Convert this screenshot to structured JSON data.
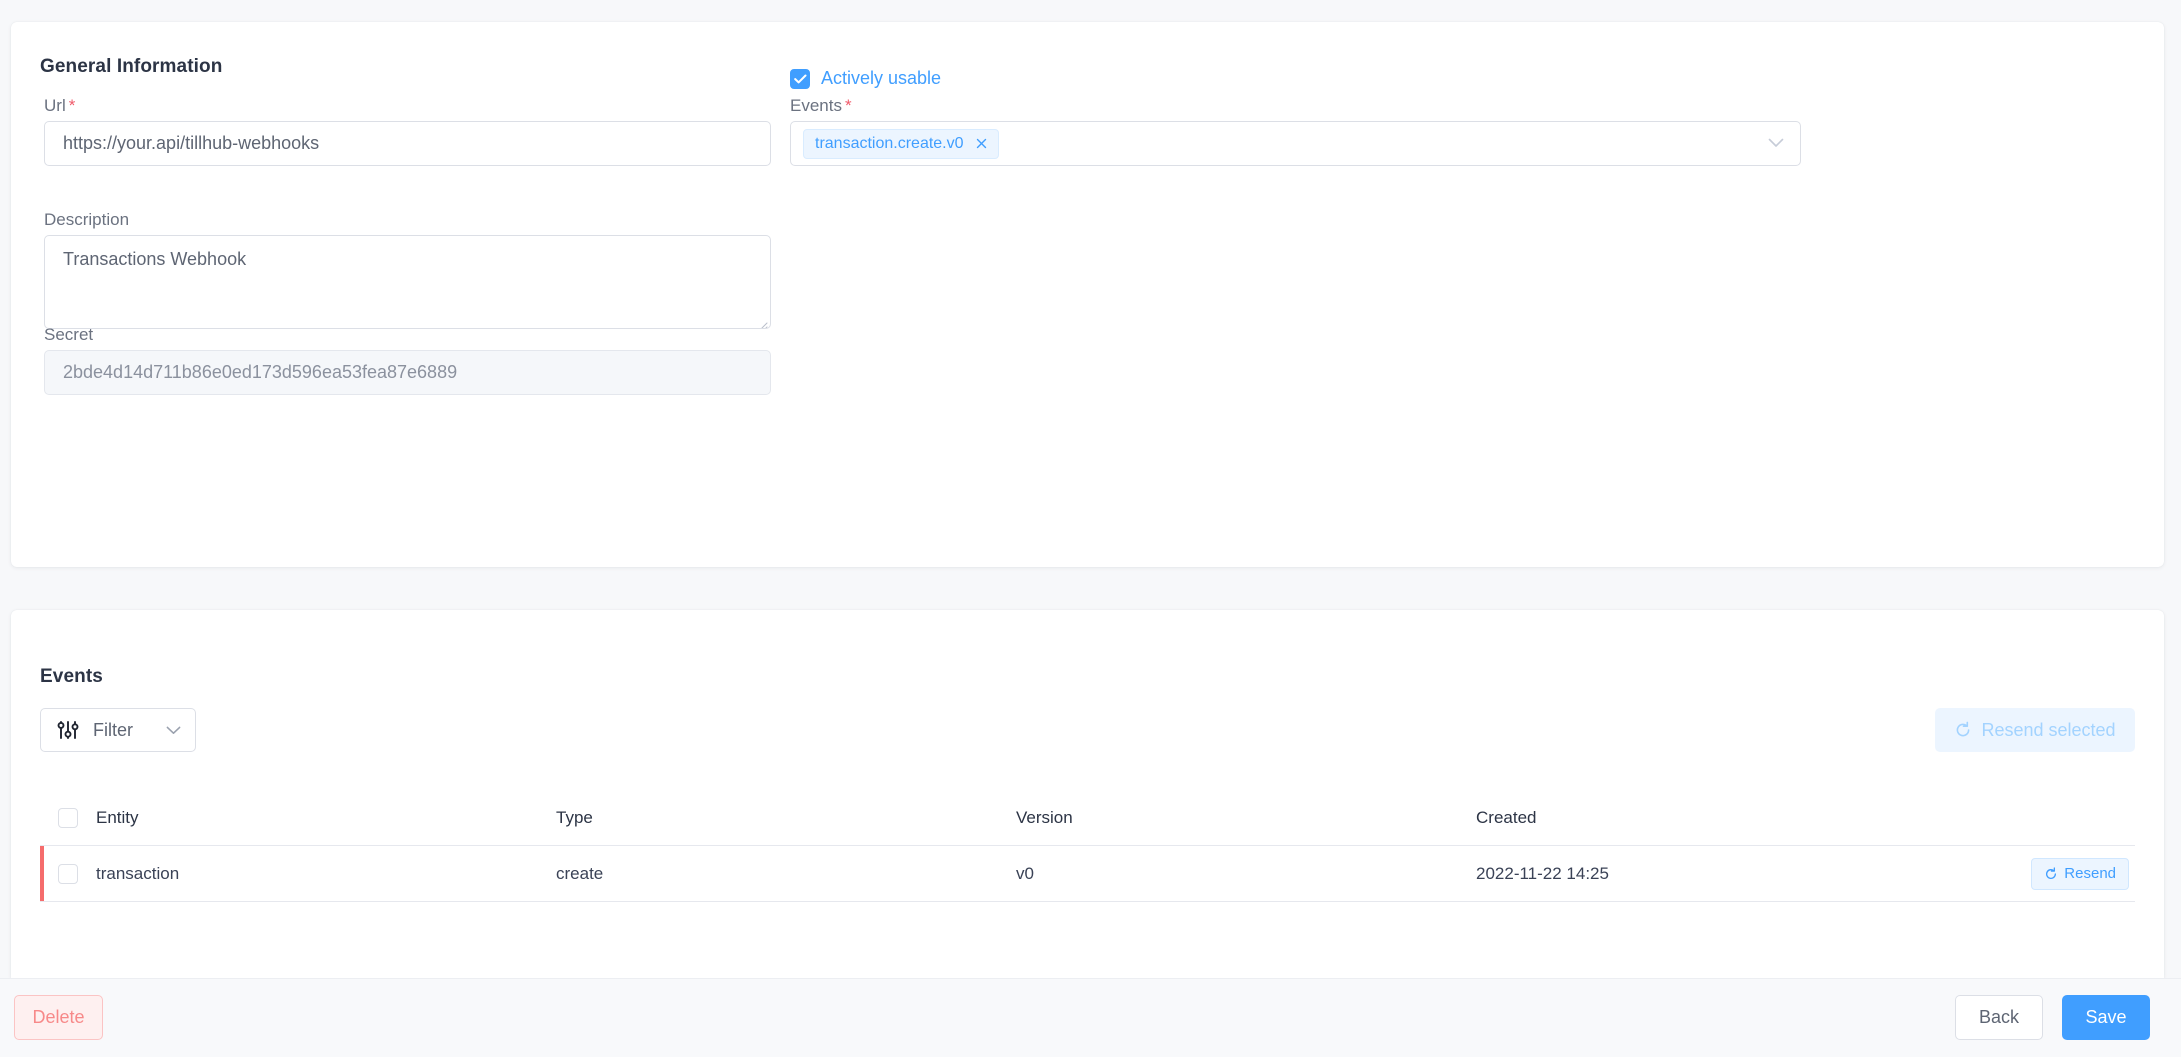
{
  "general": {
    "title": "General Information",
    "url": {
      "label": "Url",
      "required": true,
      "value": "https://your.api/tillhub-webhooks"
    },
    "description": {
      "label": "Description",
      "value": "Transactions Webhook"
    },
    "secret": {
      "label": "Secret",
      "value": "2bde4d14d711b86e0ed173d596ea53fea87e6889"
    },
    "active": {
      "label": "Actively usable",
      "checked": true
    },
    "events_select": {
      "label": "Events",
      "required": true,
      "tags": [
        "transaction.create.v0"
      ]
    }
  },
  "events": {
    "title": "Events",
    "filter": {
      "label": "Filter",
      "icon": "sliders-icon"
    },
    "resend_selected": {
      "label": "Resend selected",
      "icon": "refresh-icon",
      "disabled": true
    },
    "table": {
      "columns": [
        "Entity",
        "Type",
        "Version",
        "Created"
      ],
      "rows": [
        {
          "entity": "transaction",
          "type": "create",
          "version": "v0",
          "created": "2022-11-22 14:25",
          "action_label": "Resend"
        }
      ]
    }
  },
  "footer": {
    "delete_label": "Delete",
    "back_label": "Back",
    "save_label": "Save"
  },
  "colors": {
    "accent": "#409eff",
    "danger": "#f56c6c",
    "required": "#f05a6a",
    "page_bg": "#f7f8fa",
    "tag_bg": "#ecf5ff"
  }
}
